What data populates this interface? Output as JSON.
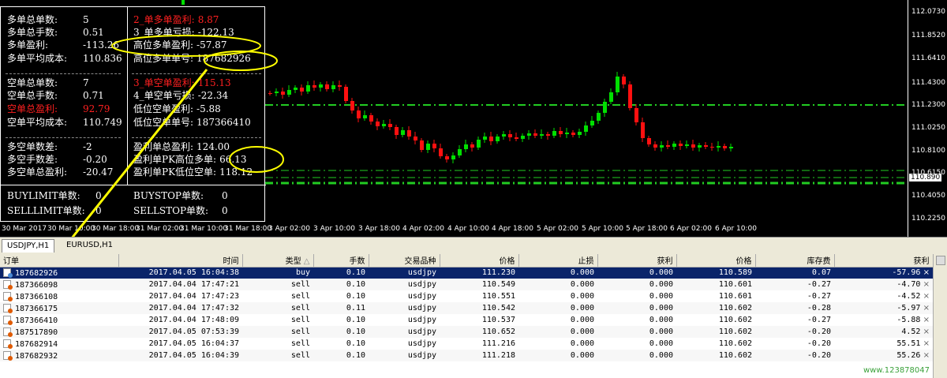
{
  "info_panel": {
    "left": [
      {
        "label": "多单总单数:",
        "value": "5",
        "red": false
      },
      {
        "label": "多单总手数:",
        "value": "0.51",
        "red": false
      },
      {
        "label": "多单盈利:",
        "value": "-113.26",
        "red": false
      },
      {
        "label": "多单平均成本:",
        "value": "110.836",
        "red": false
      },
      {
        "label": "空单总单数:",
        "value": "7",
        "red": false
      },
      {
        "label": "空单总手数:",
        "value": "0.71",
        "red": false
      },
      {
        "label": "空单总盈利:",
        "value": "92.79",
        "red": true
      },
      {
        "label": "空单平均成本:",
        "value": "110.749",
        "red": false
      },
      {
        "label": "多空单数差:",
        "value": "-2",
        "red": false
      },
      {
        "label": "多空手数差:",
        "value": "-0.20",
        "red": false
      },
      {
        "label": "多空单总盈利:",
        "value": "-20.47",
        "red": false
      }
    ],
    "right": [
      {
        "label": "2_单多单盈利:",
        "value": "8.87",
        "red": true
      },
      {
        "label": "3_单多单亏损:",
        "value": "-122.13",
        "red": false
      },
      {
        "label": "高位多单盈利:",
        "value": "-57.87",
        "red": false
      },
      {
        "label": "高位多单单号:",
        "value": "187682926",
        "red": false
      },
      {
        "label": "3_单空单盈利:",
        "value": "115.13",
        "red": true
      },
      {
        "label": "4_单空单亏损:",
        "value": "-22.34",
        "red": false
      },
      {
        "label": "低位空单盈利:",
        "value": "-5.88",
        "red": false
      },
      {
        "label": "低位空单单号:",
        "value": "187366410",
        "red": false
      },
      {
        "label": "盈利单总盈利:",
        "value": "124.00",
        "red": false
      },
      {
        "label": "盈利单PK高位多单:",
        "value": "66.13",
        "red": false
      },
      {
        "label": "盈利单PK低位空单:",
        "value": "118.12",
        "red": false
      }
    ],
    "bottom": [
      {
        "label": "BUYLIMIT单数:",
        "value": "0"
      },
      {
        "label": "BUYSTOP单数:",
        "value": "0"
      },
      {
        "label": "SELLLIMIT单数:",
        "value": "0"
      },
      {
        "label": "SELLSTOP单数:",
        "value": "0"
      }
    ]
  },
  "price_axis": {
    "labels": [
      "112.0730",
      "111.8520",
      "111.6410",
      "111.4300",
      "111.2300",
      "111.0250",
      "110.8100",
      "110.6150",
      "110.4050",
      "110.2250"
    ],
    "current": "110.890"
  },
  "time_axis": [
    "30 Mar 2017",
    "30 Mar 10:00",
    "30 Mar 18:00",
    "31 Mar 02:00",
    "31 Mar 10:00",
    "31 Mar 18:00",
    "3 Apr 02:00",
    "3 Apr 10:00",
    "3 Apr 18:00",
    "4 Apr 02:00",
    "4 Apr 10:00",
    "4 Apr 18:00",
    "5 Apr 02:00",
    "5 Apr 10:00",
    "5 Apr 18:00",
    "6 Apr 02:00",
    "6 Apr 10:00"
  ],
  "chart_tabs": [
    "USDJPY,H1",
    "EURUSD,H1"
  ],
  "orders": {
    "columns": [
      "订单",
      "时间",
      "类型",
      "手数",
      "交易品种",
      "价格",
      "止损",
      "获利",
      "价格",
      "库存费",
      "获利"
    ],
    "rows": [
      [
        "187682926",
        "2017.04.05 16:04:38",
        "buy",
        "0.10",
        "usdjpy",
        "111.230",
        "0.000",
        "0.000",
        "110.589",
        "0.07",
        "-57.96"
      ],
      [
        "187366098",
        "2017.04.04 17:47:21",
        "sell",
        "0.10",
        "usdjpy",
        "110.549",
        "0.000",
        "0.000",
        "110.601",
        "-0.27",
        "-4.70"
      ],
      [
        "187366108",
        "2017.04.04 17:47:23",
        "sell",
        "0.10",
        "usdjpy",
        "110.551",
        "0.000",
        "0.000",
        "110.601",
        "-0.27",
        "-4.52"
      ],
      [
        "187366175",
        "2017.04.04 17:47:32",
        "sell",
        "0.11",
        "usdjpy",
        "110.542",
        "0.000",
        "0.000",
        "110.602",
        "-0.28",
        "-5.97"
      ],
      [
        "187366410",
        "2017.04.04 17:48:09",
        "sell",
        "0.10",
        "usdjpy",
        "110.537",
        "0.000",
        "0.000",
        "110.602",
        "-0.27",
        "-5.88"
      ],
      [
        "187517890",
        "2017.04.05 07:53:39",
        "sell",
        "0.10",
        "usdjpy",
        "110.652",
        "0.000",
        "0.000",
        "110.602",
        "-0.20",
        "4.52"
      ],
      [
        "187682914",
        "2017.04.05 16:04:37",
        "sell",
        "0.10",
        "usdjpy",
        "111.216",
        "0.000",
        "0.000",
        "110.602",
        "-0.20",
        "55.51"
      ],
      [
        "187682932",
        "2017.04.05 16:04:39",
        "sell",
        "0.10",
        "usdjpy",
        "111.218",
        "0.000",
        "0.000",
        "110.602",
        "-0.20",
        "55.26"
      ]
    ],
    "sort_indicator": "△"
  },
  "watermark": "www.123878047",
  "colors": {
    "bull": "#00e000",
    "bear": "#ff1010",
    "level": "#22cc22",
    "highlight": "#ffff00",
    "selected": "#0a246a"
  },
  "icons": {
    "order": "ticket-icon",
    "close": "close-icon"
  }
}
